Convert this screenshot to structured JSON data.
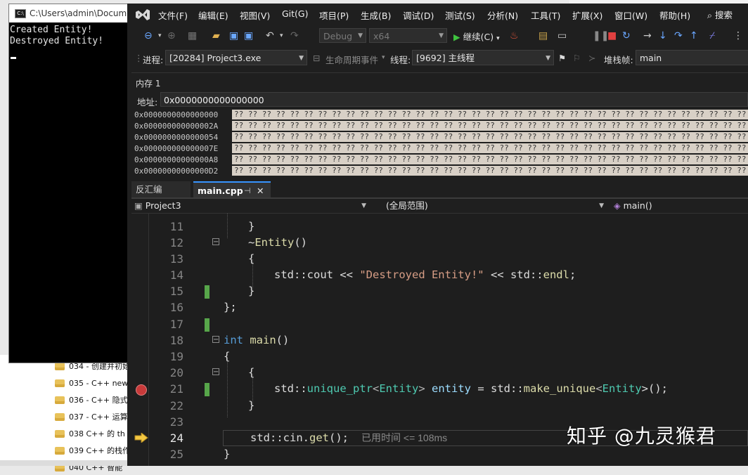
{
  "console": {
    "title": "C:\\Users\\admin\\Docume",
    "lines": [
      "Created Entity!",
      "Destroyed Entity!"
    ]
  },
  "background_explorer": {
    "items": [
      "034 - 创建并初始",
      "035 - C++ new",
      "036 - C++ 隐式",
      "037 - C++ 运算",
      "038 C++ 的 th",
      "039 C++ 的栈作",
      "040 C++ 智能"
    ]
  },
  "menu": {
    "items": [
      "文件(F)",
      "编辑(E)",
      "视图(V)",
      "Git(G)",
      "项目(P)",
      "生成(B)",
      "调试(D)",
      "测试(S)",
      "分析(N)",
      "工具(T)",
      "扩展(X)",
      "窗口(W)",
      "帮助(H)"
    ],
    "search": "搜索"
  },
  "toolbar": {
    "config": "Debug",
    "platform": "x64",
    "continue_label": "继续(C)"
  },
  "debug_location": {
    "process_label": "进程:",
    "process_value": "[20284] Project3.exe",
    "lifecycle_label": "生命周期事件",
    "thread_label": "线程:",
    "thread_value": "[9692] 主线程",
    "stack_label": "堆栈帧:",
    "stack_value": "main"
  },
  "memory": {
    "title": "内存 1",
    "address_label": "地址:",
    "address_value": "0x0000000000000000",
    "rows": [
      {
        "addr": "0x0000000000000000",
        "bytes": "?? ?? ?? ?? ?? ?? ?? ?? ?? ?? ?? ?? ?? ?? ?? ?? ?? ?? ?? ?? ?? ?? ?? ?? ?? ?? ?? ?? ?? ?? ?? ?? ?? ?? ?? ?? ?? ?? ?? ?? ?? ??"
      },
      {
        "addr": "0x000000000000002A",
        "bytes": "?? ?? ?? ?? ?? ?? ?? ?? ?? ?? ?? ?? ?? ?? ?? ?? ?? ?? ?? ?? ?? ?? ?? ?? ?? ?? ?? ?? ?? ?? ?? ?? ?? ?? ?? ?? ?? ?? ?? ?? ?? ??"
      },
      {
        "addr": "0x0000000000000054",
        "bytes": "?? ?? ?? ?? ?? ?? ?? ?? ?? ?? ?? ?? ?? ?? ?? ?? ?? ?? ?? ?? ?? ?? ?? ?? ?? ?? ?? ?? ?? ?? ?? ?? ?? ?? ?? ?? ?? ?? ?? ?? ?? ??"
      },
      {
        "addr": "0x000000000000007E",
        "bytes": "?? ?? ?? ?? ?? ?? ?? ?? ?? ?? ?? ?? ?? ?? ?? ?? ?? ?? ?? ?? ?? ?? ?? ?? ?? ?? ?? ?? ?? ?? ?? ?? ?? ?? ?? ?? ?? ?? ?? ?? ?? ??"
      },
      {
        "addr": "0x00000000000000A8",
        "bytes": "?? ?? ?? ?? ?? ?? ?? ?? ?? ?? ?? ?? ?? ?? ?? ?? ?? ?? ?? ?? ?? ?? ?? ?? ?? ?? ?? ?? ?? ?? ?? ?? ?? ?? ?? ?? ?? ?? ?? ?? ?? ??"
      },
      {
        "addr": "0x00000000000000D2",
        "bytes": "?? ?? ?? ?? ?? ?? ?? ?? ?? ?? ?? ?? ?? ?? ?? ?? ?? ?? ?? ?? ?? ?? ?? ?? ?? ?? ?? ?? ?? ?? ?? ?? ?? ?? ?? ?? ?? ?? ?? ?? ?? ??"
      }
    ]
  },
  "tabs": {
    "disasm": "反汇编",
    "main": "main.cpp"
  },
  "navbar": {
    "project": "Project3",
    "scope": "(全局范围)",
    "member": "main()"
  },
  "editor": {
    "line_numbers": [
      "11",
      "12",
      "13",
      "14",
      "15",
      "16",
      "17",
      "18",
      "19",
      "20",
      "21",
      "22",
      "23",
      "24",
      "25"
    ],
    "lines": {
      "l11": "}",
      "l12_tilde": "~",
      "l12_fn": "Entity",
      "l12_rest": "()",
      "l13": "{",
      "l14_a": "std::cout << ",
      "l14_str": "\"Destroyed Entity!\"",
      "l14_b": " << std::",
      "l14_fn": "endl",
      "l14_c": ";",
      "l15": "}",
      "l16": "};",
      "l18_kw": "int",
      "l18_fn": "main",
      "l18_rest": "()",
      "l19": "{",
      "l20": "{",
      "l21_a": "std::",
      "l21_ty": "unique_ptr",
      "l21_lt": "<",
      "l21_ty2": "Entity",
      "l21_gt": "> ",
      "l21_var": "entity",
      "l21_eq": " = std::",
      "l21_fn": "make_unique",
      "l21_lt2": "<",
      "l21_ty3": "Entity",
      "l21_end": ">();",
      "l22": "}",
      "l24_a": "std::cin.",
      "l24_fn": "get",
      "l24_b": "();",
      "l25": "}"
    },
    "elapsed": "已用时间 <= 108ms"
  },
  "watermark": "知乎 @九灵猴君"
}
